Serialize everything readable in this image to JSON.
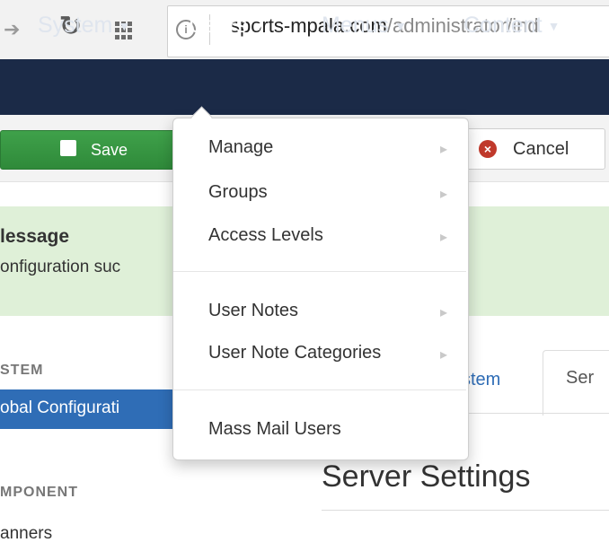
{
  "browser": {
    "url_host": "sports-mpala.com",
    "url_path": "/administrator/ind"
  },
  "navbar": {
    "items": [
      {
        "label": "System"
      },
      {
        "label": "Users"
      },
      {
        "label": "Menus"
      },
      {
        "label": "Content"
      }
    ]
  },
  "toolbar": {
    "save_label": "Save",
    "cancel_label": "Cancel"
  },
  "message": {
    "title": "lessage",
    "text": "onfiguration suc"
  },
  "sidebar": {
    "system_heading": "STEM",
    "active_item": "obal Configurati",
    "component_heading": "MPONENT",
    "items": [
      "anners"
    ]
  },
  "tabs": [
    {
      "label": "stem"
    },
    {
      "label": "Ser"
    }
  ],
  "page_title": "Server Settings",
  "users_menu": {
    "items": [
      {
        "label": "Manage",
        "has_submenu": true
      },
      {
        "label": "Groups",
        "has_submenu": true
      },
      {
        "label": "Access Levels",
        "has_submenu": true
      },
      {
        "label": "User Notes",
        "has_submenu": true
      },
      {
        "label": "User Note Categories",
        "has_submenu": true
      },
      {
        "label": "Mass Mail Users",
        "has_submenu": false
      }
    ]
  },
  "colors": {
    "navbar": "#1b2a47",
    "save_button": "#2f8a3a",
    "message_bg": "#dff0d8",
    "sidebar_active": "#2f6db6",
    "cancel_icon": "#c0392b"
  }
}
